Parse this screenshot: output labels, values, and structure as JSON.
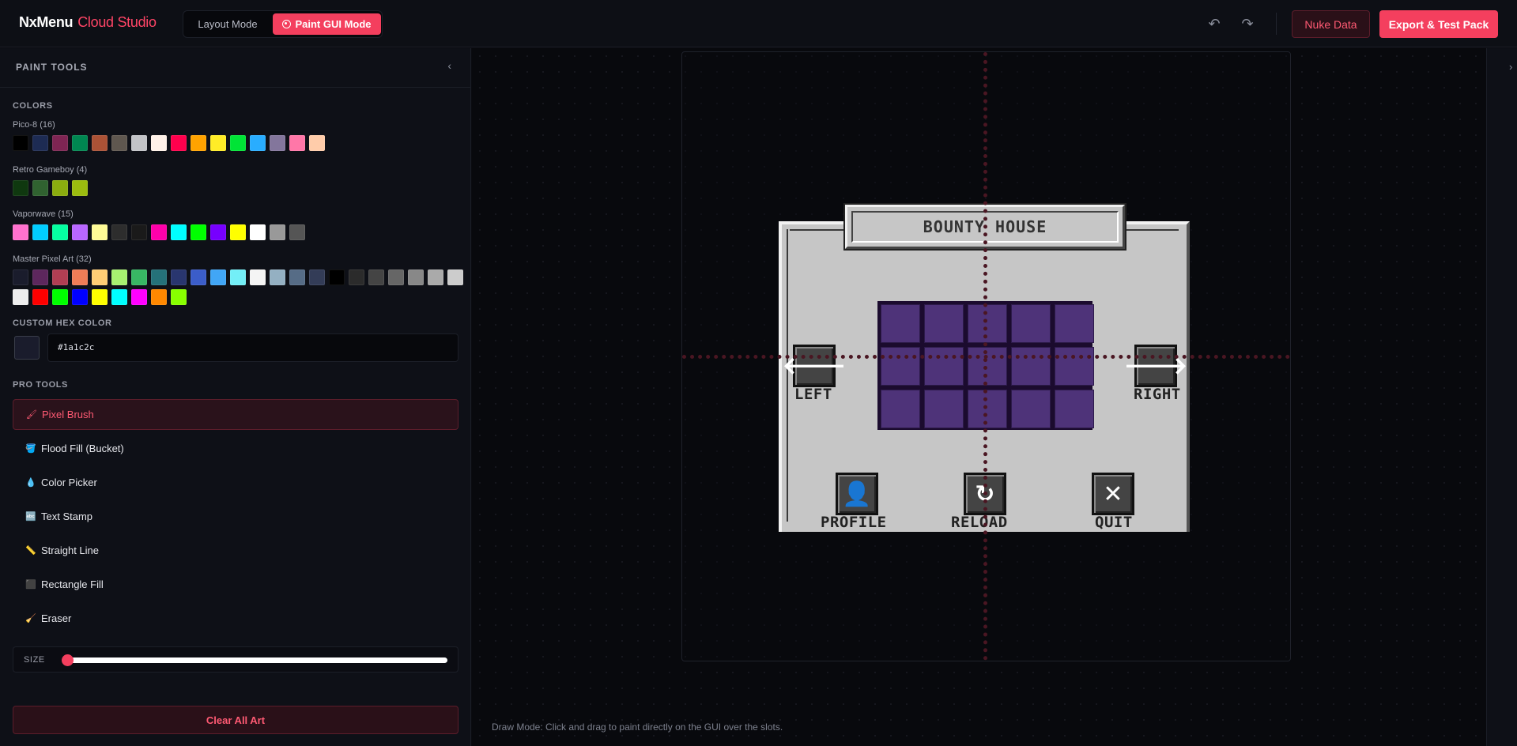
{
  "header": {
    "brand_main": "NxMenu",
    "brand_sub": "Cloud Studio",
    "layout_mode": "Layout Mode",
    "paint_mode": "Paint GUI Mode",
    "undo_glyph": "↶",
    "redo_glyph": "↷",
    "nuke_label": "Nuke Data",
    "export_label": "Export & Test Pack"
  },
  "sidebar": {
    "title": "PAINT TOOLS",
    "collapse_glyph": "‹",
    "colors_label": "COLORS",
    "palettes": [
      {
        "name": "Pico-8 (16)",
        "colors": [
          "#000000",
          "#1d2b53",
          "#7e2553",
          "#008751",
          "#ab5236",
          "#5f574f",
          "#c2c3c7",
          "#fff1e8",
          "#ff004d",
          "#ffa300",
          "#ffec27",
          "#00e436",
          "#29adff",
          "#83769c",
          "#ff77a8",
          "#ffccaa"
        ]
      },
      {
        "name": "Retro Gameboy (4)",
        "colors": [
          "#0f380f",
          "#306230",
          "#8bac0f",
          "#9bbc0f"
        ]
      },
      {
        "name": "Vaporwave (15)",
        "colors": [
          "#ff71ce",
          "#01cdfe",
          "#05ffa1",
          "#b967ff",
          "#fffb96",
          "#2d2d2d",
          "#1a1a1a",
          "#ff00aa",
          "#00ffff",
          "#00ff00",
          "#7700ff",
          "#ffff00",
          "#ffffff",
          "#999999",
          "#555555"
        ]
      },
      {
        "name": "Master Pixel Art (32)",
        "colors": [
          "#1a1c2c",
          "#5d275d",
          "#b13e53",
          "#ef7d57",
          "#ffcd75",
          "#a7f070",
          "#38b764",
          "#257179",
          "#29366f",
          "#3b5dc9",
          "#41a6f6",
          "#73eff7",
          "#f4f4f4",
          "#94b0c2",
          "#566c86",
          "#333c57",
          "#000000",
          "#2b2b2b",
          "#444444",
          "#666666",
          "#888888",
          "#aaaaaa",
          "#cccccc",
          "#eeeeee",
          "#ff0000",
          "#00ff00",
          "#0000ff",
          "#ffff00",
          "#00ffff",
          "#ff00ff",
          "#ff8800",
          "#88ff00"
        ]
      }
    ],
    "custom_hex_label": "CUSTOM HEX COLOR",
    "custom_hex_value": "#1a1c2c",
    "pro_tools_label": "PRO TOOLS",
    "tools": [
      {
        "label": "Pixel Brush",
        "icon": "🖌",
        "name": "pixel-brush"
      },
      {
        "label": "Flood Fill (Bucket)",
        "icon": "🪣",
        "name": "flood-fill"
      },
      {
        "label": "Color Picker",
        "icon": "💧",
        "name": "color-picker"
      },
      {
        "label": "Text Stamp",
        "icon": "🔤",
        "name": "text-stamp"
      },
      {
        "label": "Straight Line",
        "icon": "📏",
        "name": "straight-line"
      },
      {
        "label": "Rectangle Fill",
        "icon": "⬛",
        "name": "rectangle-fill"
      },
      {
        "label": "Eraser",
        "icon": "🧹",
        "name": "eraser"
      }
    ],
    "size_label": "SIZE",
    "size_value": 0.0,
    "clear_label": "Clear All Art"
  },
  "canvas": {
    "expand_glyph": "›",
    "gui_title": "BOUNTY HOUSE",
    "slot_count": 15,
    "buttons": [
      {
        "glyph": "🡐",
        "label": "LEFT"
      },
      {
        "glyph": "🡒",
        "label": "RIGHT"
      },
      {
        "glyph": "👤",
        "label": "PROFILE"
      },
      {
        "glyph": "↻",
        "label": "RELOAD"
      },
      {
        "glyph": "✕",
        "label": "QUIT"
      }
    ],
    "status": "Draw Mode: Click and drag to paint directly on the GUI over the slots."
  }
}
